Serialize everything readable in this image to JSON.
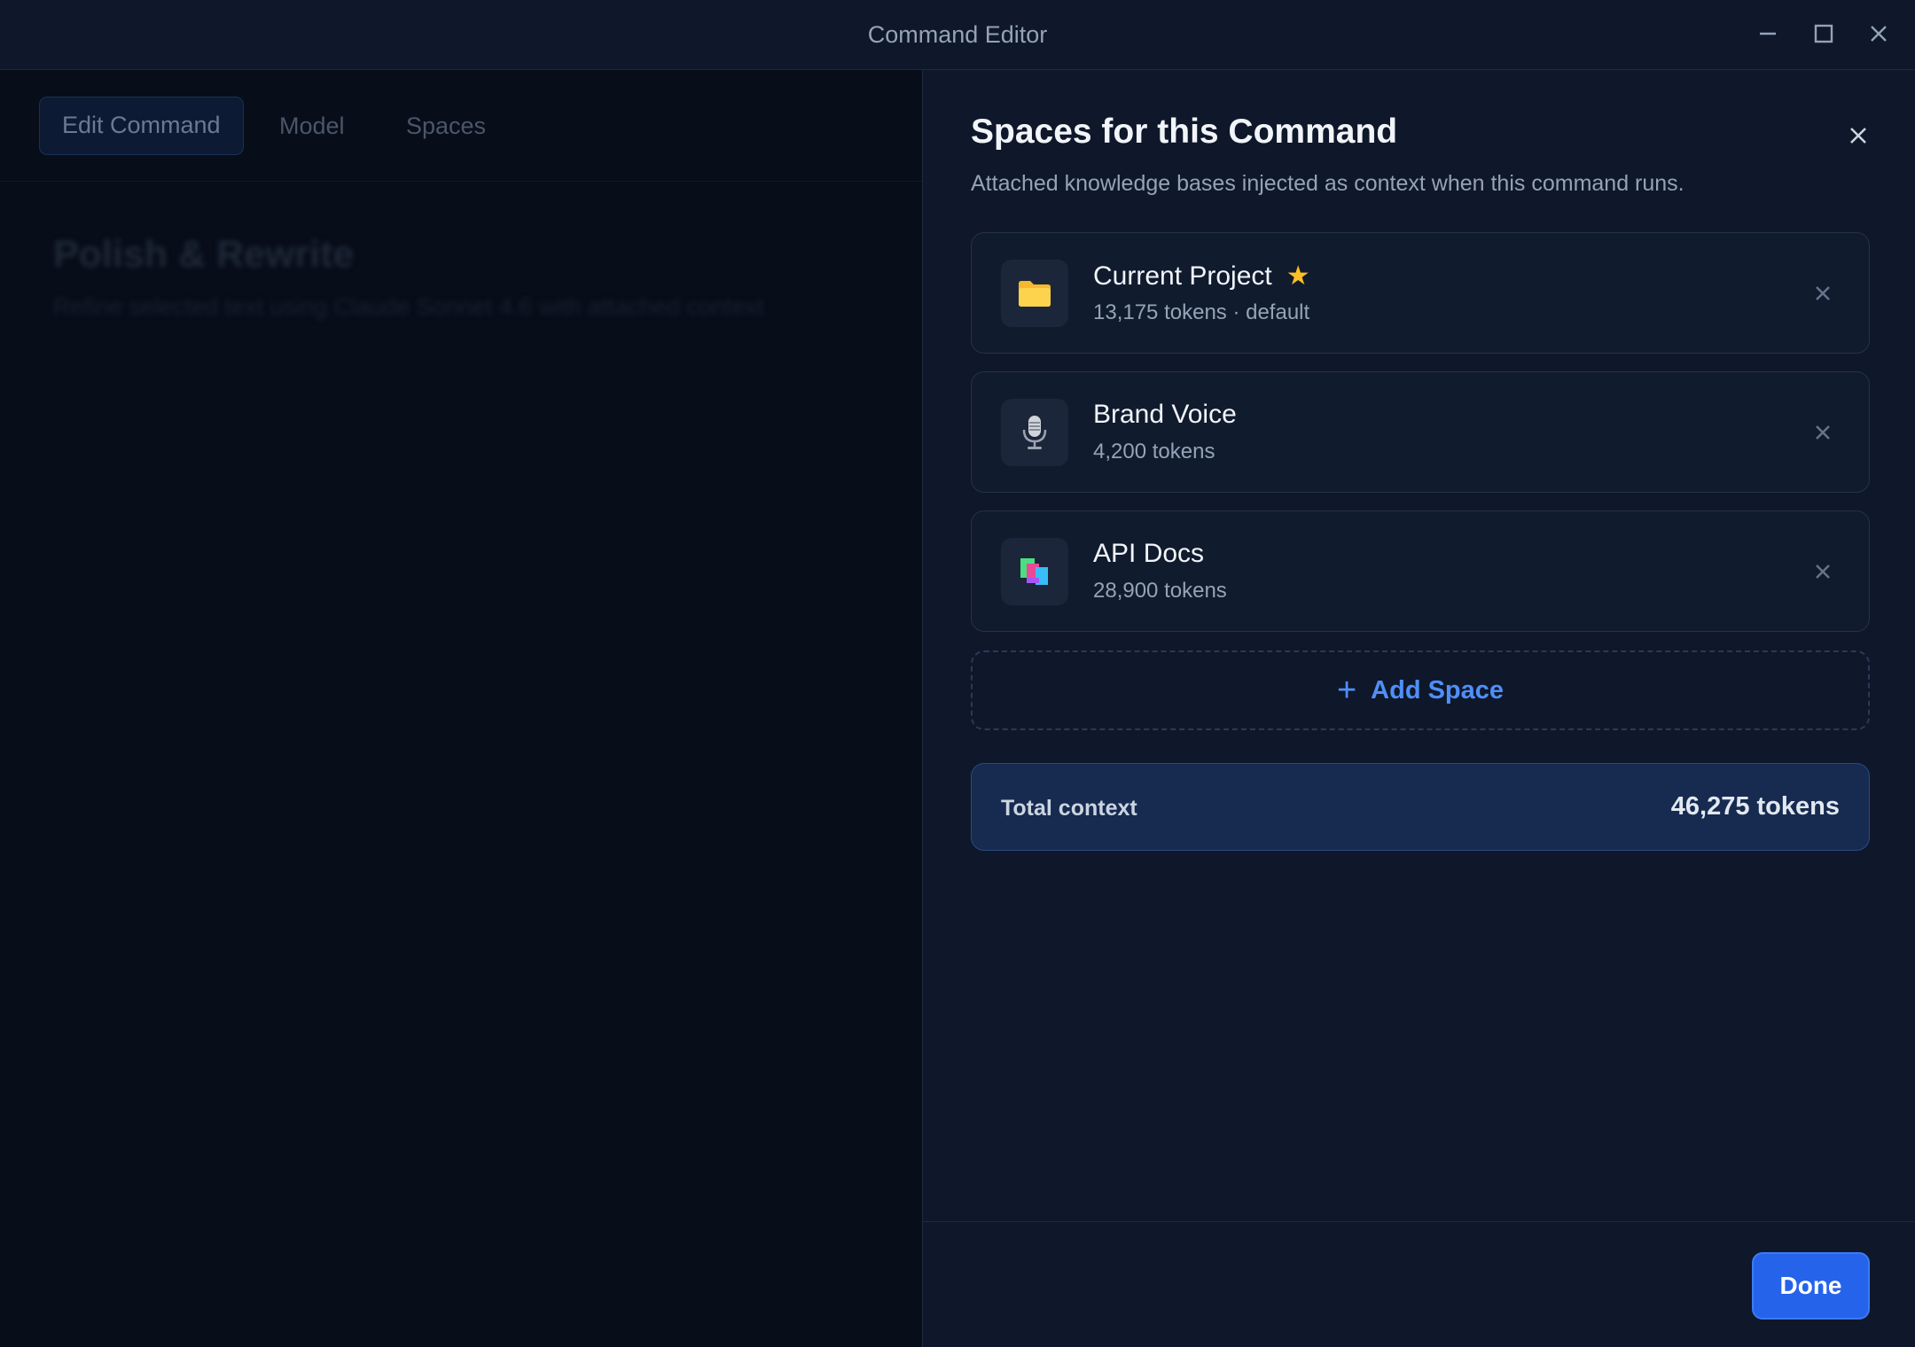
{
  "window": {
    "title": "Command Editor"
  },
  "tabs": [
    {
      "label": "Edit Command",
      "active": true
    },
    {
      "label": "Model",
      "active": false
    },
    {
      "label": "Spaces",
      "active": false
    }
  ],
  "command": {
    "title": "Polish & Rewrite",
    "description": "Refine selected text using Claude Sonnet 4.6 with attached context"
  },
  "panel": {
    "title": "Spaces for this Command",
    "subtitle": "Attached knowledge bases injected as context when this command runs.",
    "spaces": [
      {
        "name": "Current Project",
        "meta": "13,175 tokens · default",
        "icon": "folder-icon",
        "starred": true
      },
      {
        "name": "Brand Voice",
        "meta": "4,200 tokens",
        "icon": "microphone-icon",
        "starred": false
      },
      {
        "name": "API Docs",
        "meta": "28,900 tokens",
        "icon": "books-icon",
        "starred": false
      }
    ],
    "add_label": "Add Space",
    "total_label": "Total context",
    "total_value": "46,275 tokens",
    "done_label": "Done"
  },
  "colors": {
    "accent": "#2563eb",
    "link": "#4f8ff7",
    "star": "#fbbf24",
    "panel_bg": "#0f172a"
  }
}
